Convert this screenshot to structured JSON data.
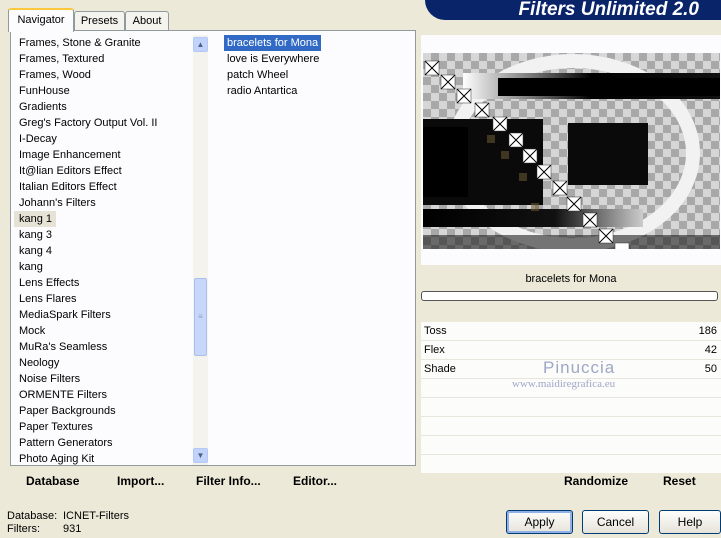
{
  "app": {
    "banner": "Filters Unlimited 2.0"
  },
  "tabs": [
    {
      "label": "Navigator",
      "active": true
    },
    {
      "label": "Presets",
      "active": false
    },
    {
      "label": "About",
      "active": false
    }
  ],
  "categories": [
    "Frames, Stone & Granite",
    "Frames, Textured",
    "Frames, Wood",
    "FunHouse",
    "Gradients",
    "Greg's Factory Output Vol. II",
    "I-Decay",
    "Image Enhancement",
    "It@lian Editors Effect",
    "Italian Editors Effect",
    "Johann's Filters",
    "kang 1",
    "kang 3",
    "kang 4",
    "kang",
    "Lens Effects",
    "Lens Flares",
    "MediaSpark Filters",
    "Mock",
    "MuRa's Seamless",
    "Neology",
    "Noise Filters",
    "ORMENTE Filters",
    "Paper Backgrounds",
    "Paper Textures",
    "Pattern Generators",
    "Photo Aging Kit"
  ],
  "selected_category": "kang 1",
  "filters": [
    "bracelets for Mona",
    "love is Everywhere",
    "patch Wheel",
    "radio Antartica"
  ],
  "selected_filter": "bracelets for Mona",
  "preview": {
    "filter_name": "bracelets for Mona",
    "progress": 0
  },
  "params": [
    {
      "name": "Toss",
      "value": "186"
    },
    {
      "name": "Flex",
      "value": "42"
    },
    {
      "name": "Shade",
      "value": "50"
    }
  ],
  "watermark": {
    "line1": "Pinuccia",
    "line2": "www.maidiregrafica.eu"
  },
  "actions": {
    "database": "Database",
    "import": "Import...",
    "filter_info": "Filter Info...",
    "editor": "Editor...",
    "randomize": "Randomize",
    "reset": "Reset"
  },
  "status": {
    "database_label": "Database:",
    "database_value": "ICNET-Filters",
    "filters_label": "Filters:",
    "filters_value": "931"
  },
  "buttons": {
    "apply": "Apply",
    "cancel": "Cancel",
    "help": "Help"
  }
}
